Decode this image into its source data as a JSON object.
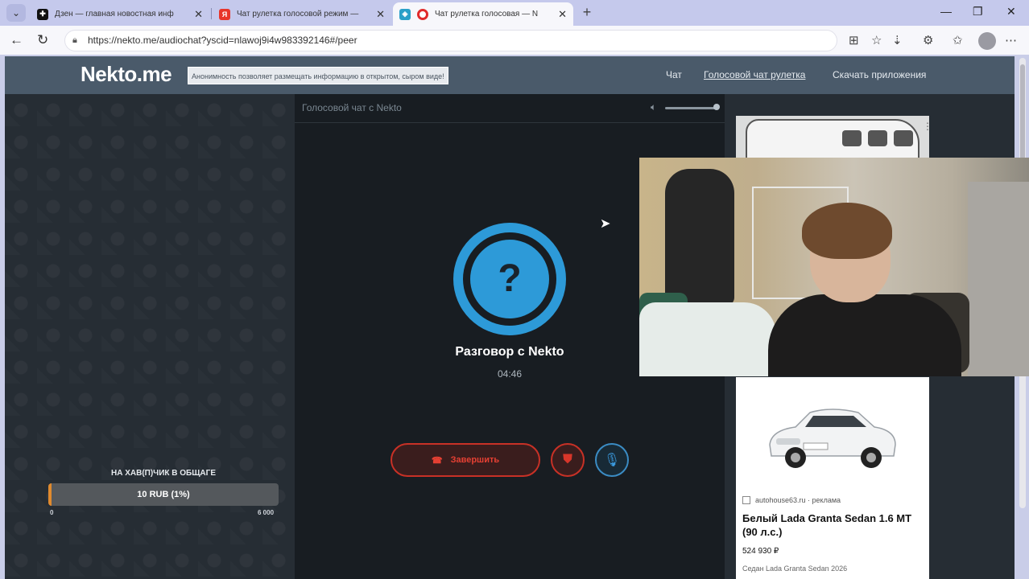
{
  "browser": {
    "tabs": [
      {
        "title": "Дзен — главная новостная инф",
        "favicon": "dzen-icon",
        "active": false
      },
      {
        "title": "Чат рулетка голосовой режим —",
        "favicon": "yandex-icon",
        "active": false
      },
      {
        "title": "Чат рулетка голосовая — N",
        "favicon": "record-icon",
        "active": true
      }
    ],
    "url": "https://nekto.me/audiochat?yscid=nlawoj9i4w983392146#/peer"
  },
  "site": {
    "logo": "Nekto.me",
    "notice": "Анонимность позволяет размещать информацию в открытом, сыром виде!",
    "nav": [
      "Чат",
      "Голосовой чат рулетка",
      "Скачать приложения"
    ]
  },
  "donation": {
    "title": "НА ХАВ(П)ЧИК В ОБЩАГЕ",
    "amount": "10 RUB (1%)",
    "progress_percent": 1,
    "min": "0",
    "max": "6 000"
  },
  "chat": {
    "header": "Голосовой чат с Nekto",
    "volume_level": 1.0,
    "avatar_symbol": "?",
    "title": "Разговор с Nekto",
    "timer": "04:46",
    "end_label": "Завершить"
  },
  "ad": {
    "source": "autohouse63.ru · реклама",
    "title": "Белый Lada Granta Sedan 1.6 MT (90 л.с.)",
    "price": "524 930 ₽",
    "desc": "Седан Lada Granta Sedan 2026"
  },
  "colors": {
    "accent_blue": "#2d9ad8",
    "danger_red": "#c83126",
    "donation_orange": "#e08a2e",
    "header_bg": "#4a5a6a"
  }
}
